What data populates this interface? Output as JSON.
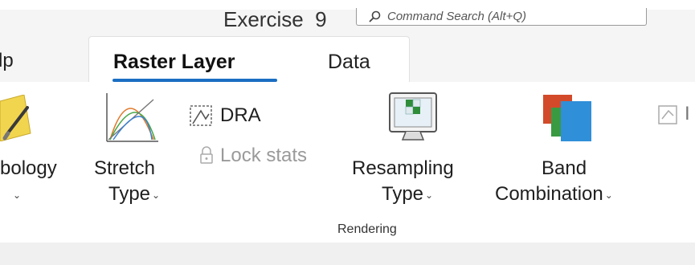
{
  "window": {
    "document_title": "Exercise_9",
    "search_placeholder": "Command Search (Alt+Q)"
  },
  "tabs": {
    "help_partial": "lp",
    "raster_layer": "Raster Layer",
    "data": "Data"
  },
  "ribbon": {
    "symbology": {
      "label": "bology",
      "icon": "symbology-brush-icon"
    },
    "stretch_type": {
      "line1": "Stretch",
      "line2": "Type",
      "icon": "stretch-curve-icon"
    },
    "dra": {
      "label": "DRA",
      "icon": "dra-icon"
    },
    "lock_stats": {
      "label": "Lock stats",
      "icon": "lock-icon",
      "enabled": false
    },
    "resampling_type": {
      "line1": "Resampling",
      "line2": "Type",
      "icon": "resampling-monitor-icon"
    },
    "band_combination": {
      "line1": "Band",
      "line2": "Combination",
      "icon": "band-combination-icon"
    },
    "partial_right": {
      "label": "I",
      "icon": "partial-icon"
    },
    "group_label": "Rendering"
  },
  "colors": {
    "tab_underline": "#1b6ec2",
    "band_red": "#d34a2a",
    "band_green": "#3a9a42",
    "band_blue": "#2f8fd8"
  }
}
